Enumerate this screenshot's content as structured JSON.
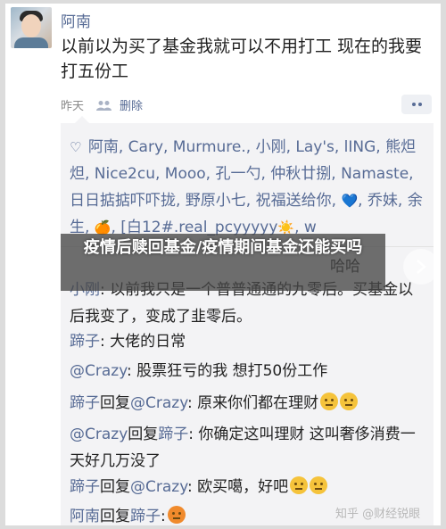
{
  "post": {
    "author": "阿南",
    "text": "以前以为买了基金我就可以不用打工 现在的我要打五份工",
    "time": "昨天",
    "delete_label": "删除"
  },
  "likes": {
    "text_part1": "阿南, Cary, Murmure., 小刚, Lay's, lING, 熊炟炟, Nice2cu, Mooo, 孔一勺, 仲秋廿捌, Namaste, 日日掂掂吓吓拢, 野原小七, 祝福送给你,",
    "heart_emoji": "💙",
    "text_part2": ", 乔妹, 余生,",
    "orange_emoji": "🍊",
    "text_part3": ", [白12#.real_pcyyyyy",
    "sun_emoji": "☀️",
    "text_part4": ", w"
  },
  "comments": [
    {
      "name": "",
      "text": "哈哈"
    },
    {
      "name": "小刚",
      "text": ": 以前我只是一个普普通通的九零后。买基金以后我变了，变成了韭零后。"
    },
    {
      "name": "蹄子",
      "text": ": 大佬的日常"
    },
    {
      "name": "@Crazy",
      "text": ": 股票狂亏的我  想打50份工作"
    },
    {
      "name": "蹄子",
      "reply": "回复",
      "target": "@Crazy",
      "text": ": 原来你们都在理财"
    },
    {
      "name": "@Crazy",
      "reply": "回复",
      "target": "蹄子",
      "text": ": 你确定这叫理财 这叫奢侈消费一天好几万没了"
    },
    {
      "name": "蹄子",
      "reply": "回复",
      "target": "@Crazy",
      "text": ": 欧买噶，好吧"
    },
    {
      "name": "阿南",
      "reply": "回复",
      "target": "蹄子",
      "text": ":"
    }
  ],
  "overlay": {
    "title": "疫情后赎回基金/疫情期间基金还能买吗"
  },
  "watermark": "知乎 @财经锐眼"
}
